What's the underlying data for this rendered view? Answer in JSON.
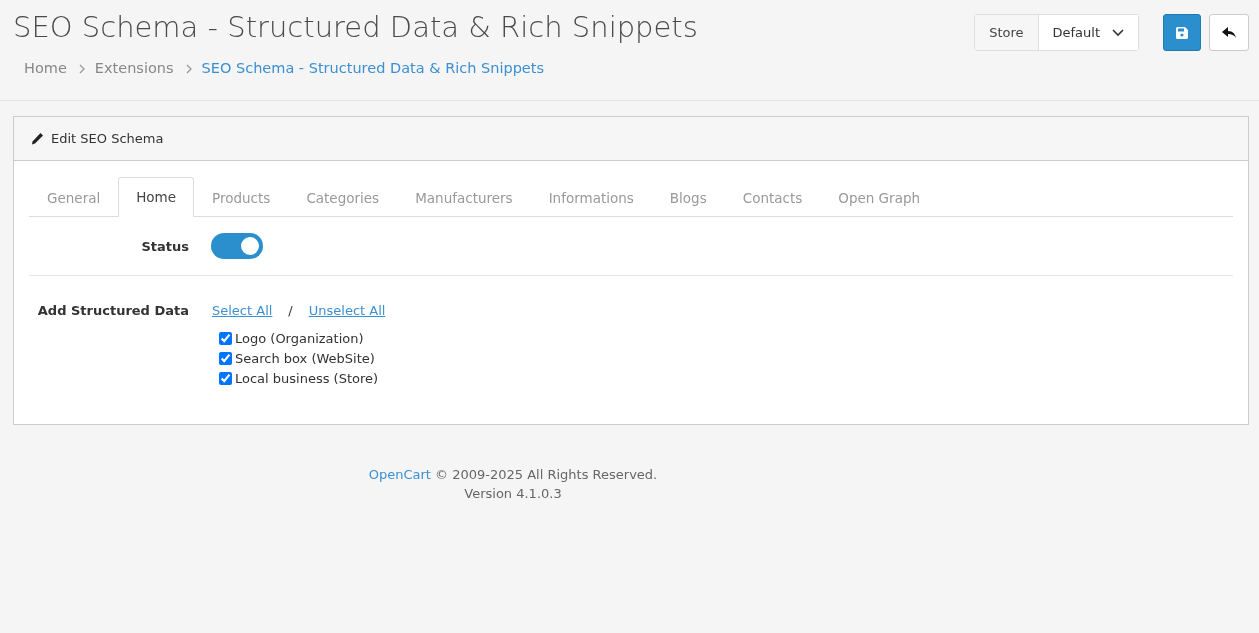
{
  "page_title": "SEO Schema - Structured Data & Rich Snippets",
  "breadcrumbs": [
    {
      "label": "Home",
      "active": false
    },
    {
      "label": "Extensions",
      "active": false
    },
    {
      "label": "SEO Schema - Structured Data & Rich Snippets",
      "active": true
    }
  ],
  "store_select": {
    "label": "Store",
    "value": "Default"
  },
  "card": {
    "title": "Edit SEO Schema",
    "tabs": [
      {
        "label": "General",
        "selected": false
      },
      {
        "label": "Home",
        "selected": true
      },
      {
        "label": "Products",
        "selected": false
      },
      {
        "label": "Categories",
        "selected": false
      },
      {
        "label": "Manufacturers",
        "selected": false
      },
      {
        "label": "Informations",
        "selected": false
      },
      {
        "label": "Blogs",
        "selected": false
      },
      {
        "label": "Contacts",
        "selected": false
      },
      {
        "label": "Open Graph",
        "selected": false
      }
    ],
    "status": {
      "label": "Status",
      "on": true
    },
    "structured_data": {
      "label": "Add Structured Data",
      "select_all": "Select All",
      "separator": "/",
      "unselect_all": "Unselect All",
      "options": [
        {
          "label": "Logo (Organization)",
          "checked": true
        },
        {
          "label": "Search box (WebSite)",
          "checked": true
        },
        {
          "label": "Local business (Store)",
          "checked": true
        }
      ]
    }
  },
  "footer": {
    "link": "OpenCart",
    "text": "© 2009-2025 All Rights Reserved.",
    "version": "Version 4.1.0.3"
  }
}
